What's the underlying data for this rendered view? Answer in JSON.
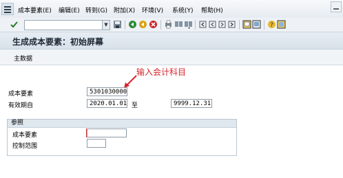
{
  "menu": {
    "items": [
      {
        "label": "成本要素(E)"
      },
      {
        "label": "编辑(E)"
      },
      {
        "label": "转到(G)"
      },
      {
        "label": "附加(X)"
      },
      {
        "label": "环境(V)"
      },
      {
        "label": "系统(Y)"
      },
      {
        "label": "帮助(H)"
      }
    ]
  },
  "toolbar": {
    "command_value": "",
    "icons": [
      "enter-icon",
      "save-icon",
      "back-icon",
      "exit-icon",
      "cancel-icon",
      "print-icon",
      "find-icon",
      "find-next-icon",
      "first-page-icon",
      "prev-page-icon",
      "next-page-icon",
      "last-page-icon",
      "new-session-icon",
      "shortcut-icon",
      "help-icon",
      "layout-icon"
    ]
  },
  "page": {
    "title": "生成成本要素：初始屏幕",
    "app_button": "主数据"
  },
  "annotation": {
    "text": "输入会计科目",
    "color": "#d6252b"
  },
  "form": {
    "cost_element_label": "成本要素",
    "cost_element_value": "5301030000",
    "valid_from_label": "有效期自",
    "valid_from_value": "2020.01.01",
    "to_label": "至",
    "valid_to_value": "9999.12.31"
  },
  "reference": {
    "group_title": "参照",
    "cost_element_label": "成本要素",
    "cost_element_value": "",
    "controlling_area_label": "控制范围",
    "controlling_area_value": ""
  }
}
